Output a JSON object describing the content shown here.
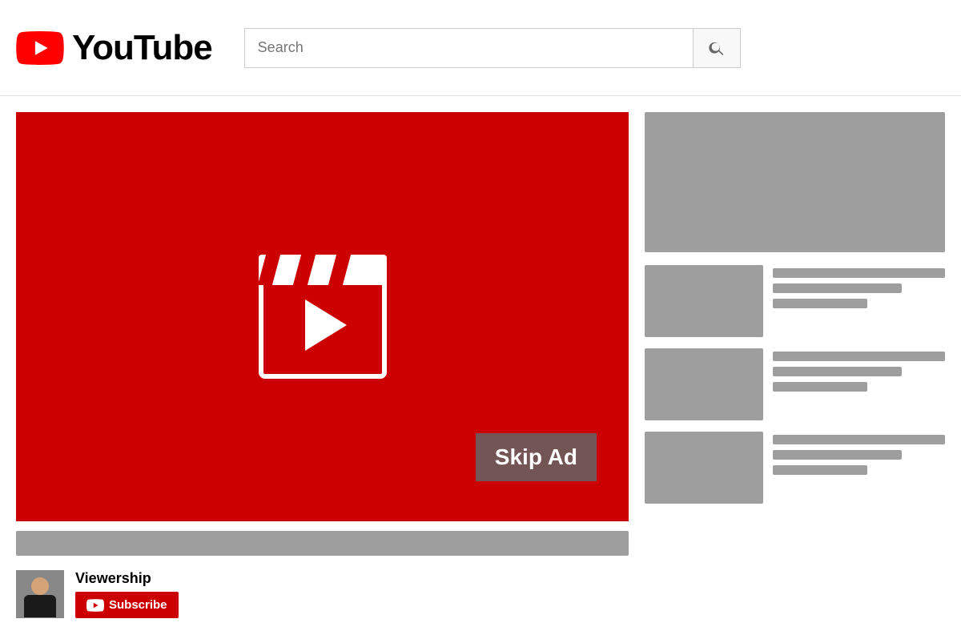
{
  "header": {
    "logo_text": "YouTube",
    "search_placeholder": "Search",
    "search_button_label": "Search"
  },
  "video": {
    "skip_ad_label": "Skip Ad",
    "is_playing": false
  },
  "channel": {
    "name": "Viewership",
    "subscribe_label": "Subscribe"
  },
  "sidebar": {
    "banner_alt": "Advertisement banner",
    "suggested_items": [
      {
        "id": 1
      },
      {
        "id": 2
      },
      {
        "id": 3
      }
    ]
  },
  "icons": {
    "search": "🔍",
    "play": "▶"
  }
}
